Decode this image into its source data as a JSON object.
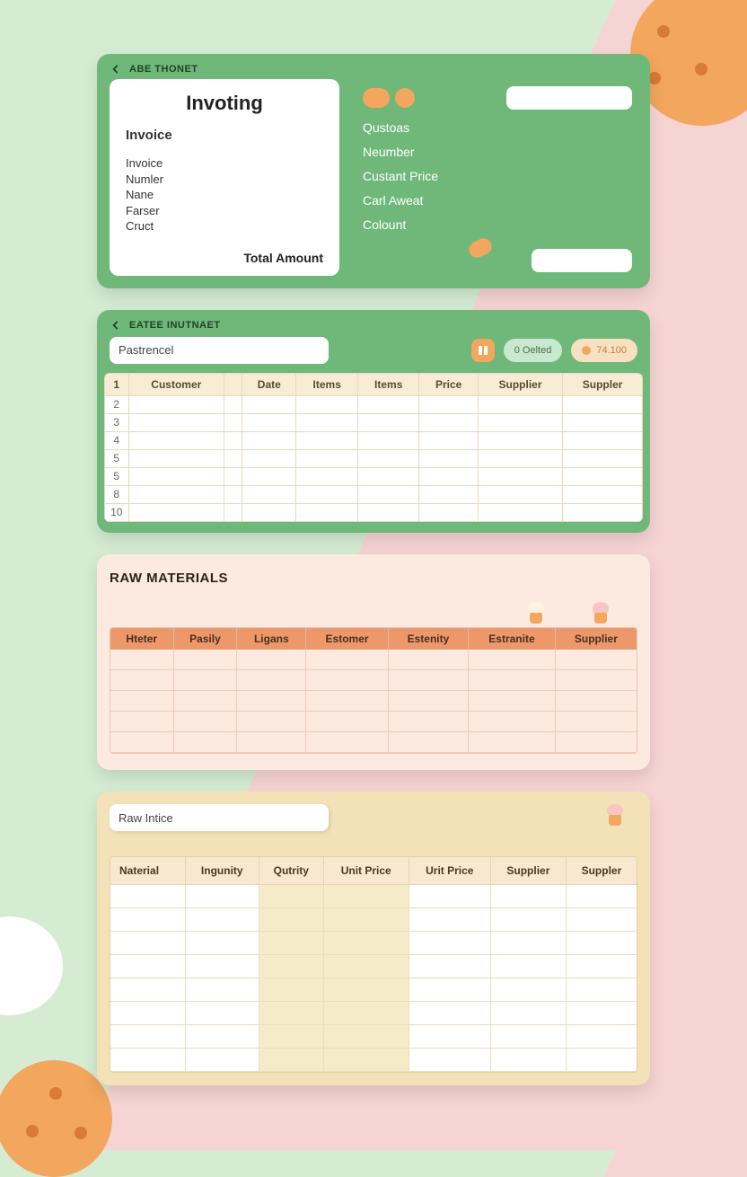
{
  "card1": {
    "back_label": "ABE THONET",
    "title": "Invoting",
    "invoice_heading": "Invoice",
    "fields": [
      "Invoice",
      "Numler",
      "Nane",
      "Farser",
      "Cruct"
    ],
    "total_label": "Total Amount",
    "right_fields": [
      "Qustoas",
      "Neumber",
      "Custant Price",
      "Carl Aweat",
      "Colount"
    ]
  },
  "card2": {
    "back_label": "EATEE INUTNAET",
    "search_value": "Pastrencel",
    "badge1": "0 Oelted",
    "badge2": "74.100",
    "headers": [
      "",
      "Customer",
      "",
      "Date",
      "Items",
      "Items",
      "Price",
      "Supplier",
      "Suppler"
    ],
    "row_numbers": [
      "1",
      "2",
      "3",
      "4",
      "5",
      "5",
      "8",
      "10"
    ]
  },
  "card3": {
    "title": "RAW MATERIALS",
    "headers": [
      "Hteter",
      "Pasily",
      "Ligans",
      "Estomer",
      "Estenity",
      "Estranite",
      "Supplier"
    ],
    "row_count": 5
  },
  "card4": {
    "search_value": "Raw Intice",
    "headers": [
      "Naterial",
      "Ingunity",
      "Qutrity",
      "Unit Price",
      "Urit Price",
      "Supplier",
      "Suppler"
    ],
    "row_count": 8
  }
}
